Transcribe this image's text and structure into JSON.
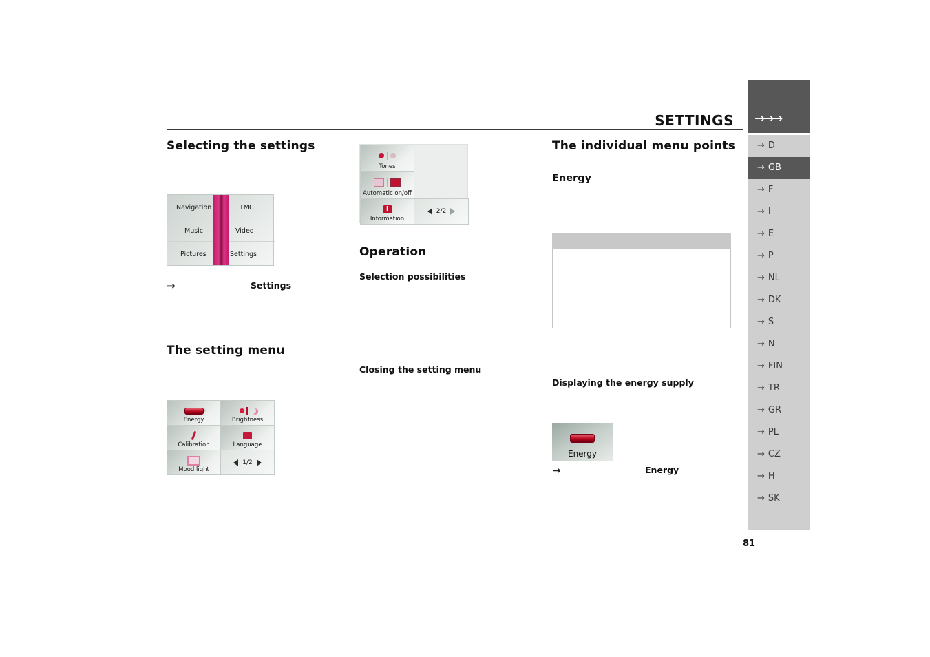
{
  "header": {
    "title": "SETTINGS",
    "tab_arrows": "→→→"
  },
  "language_rail": {
    "items": [
      {
        "code": "D",
        "active": false
      },
      {
        "code": "GB",
        "active": true
      },
      {
        "code": "F",
        "active": false
      },
      {
        "code": "I",
        "active": false
      },
      {
        "code": "E",
        "active": false
      },
      {
        "code": "P",
        "active": false
      },
      {
        "code": "NL",
        "active": false
      },
      {
        "code": "DK",
        "active": false
      },
      {
        "code": "S",
        "active": false
      },
      {
        "code": "N",
        "active": false
      },
      {
        "code": "FIN",
        "active": false
      },
      {
        "code": "TR",
        "active": false
      },
      {
        "code": "GR",
        "active": false
      },
      {
        "code": "PL",
        "active": false
      },
      {
        "code": "CZ",
        "active": false
      },
      {
        "code": "H",
        "active": false
      },
      {
        "code": "SK",
        "active": false
      }
    ],
    "arrow_glyph": "→"
  },
  "page_number": "81",
  "col1": {
    "heading": "Selecting the settings",
    "main_menu_screenshot": {
      "cells": [
        {
          "label": "Navigation"
        },
        {
          "label": "TMC"
        },
        {
          "label": "Music"
        },
        {
          "label": "Video"
        },
        {
          "label": "Pictures"
        },
        {
          "label": "Settings"
        }
      ]
    },
    "caption": {
      "arrow": "→",
      "text": "Settings"
    },
    "heading2": "The setting menu",
    "setting_menu_screenshot": {
      "tiles": [
        {
          "label": "Energy",
          "icon": "battery-icon"
        },
        {
          "label": "Brightness",
          "icon": "sun-moon-icon"
        },
        {
          "label": "Calibration",
          "icon": "pen-icon"
        },
        {
          "label": "Language",
          "icon": "flag-icon"
        },
        {
          "label": "Mood light",
          "icon": "lamp-icon"
        }
      ],
      "pager": {
        "prev": "◀",
        "page": "1/2",
        "next": "▶"
      }
    }
  },
  "col2": {
    "settings_page2_screenshot": {
      "tiles": [
        {
          "label": "Tones",
          "icon": "tones-icon"
        },
        {
          "label": "Automatic on/off",
          "icon": "screen-onoff-icon"
        },
        {
          "label": "Information",
          "icon": "info-icon"
        }
      ],
      "pager": {
        "prev": "◀",
        "page": "2/2",
        "next": "▶"
      }
    },
    "heading": "Operation",
    "sub1": "Selection possibilities",
    "sub2": "Closing the setting menu"
  },
  "col3": {
    "heading": "The individual menu points",
    "sub_energy": "Energy",
    "note_box": {
      "header_text": "",
      "body_text": ""
    },
    "sub_display": "Displaying the energy supply",
    "energy_tile": {
      "label": "Energy",
      "icon": "battery-icon"
    },
    "caption": {
      "arrow": "→",
      "text": "Energy"
    }
  },
  "colors": {
    "dark_tab": "#575757",
    "rail_bg": "#cfcfcf",
    "accent_pink": "#c9186a",
    "accent_red": "#c21232",
    "note_head": "#c8c8c8"
  }
}
